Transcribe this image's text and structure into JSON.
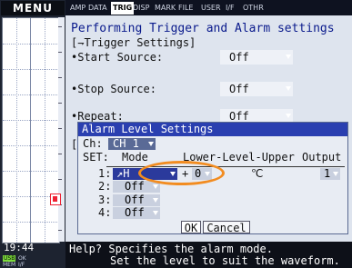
{
  "left": {
    "menu_label": "MENU",
    "time": "19:44",
    "usb_badge": "USB",
    "usb_sub": "MEM",
    "usb_menu": "OK\nI/F"
  },
  "tabs": [
    {
      "label": "AMP",
      "active": false
    },
    {
      "label": "DATA",
      "active": false
    },
    {
      "label": "TRIG",
      "active": true
    },
    {
      "label": "DISP",
      "active": false
    },
    {
      "label": "MARK",
      "active": false
    },
    {
      "label": "FILE",
      "active": false
    },
    {
      "label": "USER",
      "active": false
    },
    {
      "label": "I/F",
      "active": false
    },
    {
      "label": "OTHR",
      "active": false
    }
  ],
  "main": {
    "help_title": "Performing Trigger and Alarm settings",
    "section": "[⇁Trigger Settings]",
    "start_source_label": "•Start Source:",
    "start_source_value": "Off",
    "stop_source_label": "•Stop Source:",
    "stop_source_value": "Off",
    "repeat_label": "•Repeat:",
    "repeat_value": "Off",
    "hidden_bracket": "["
  },
  "dialog": {
    "title": "Alarm Level Settings",
    "ch_label": "Ch:",
    "ch_value": "CH 1",
    "set_label": "SET:",
    "col_mode": "Mode",
    "col_range": "Lower-Level-Upper",
    "col_output": "Output",
    "rows": [
      {
        "num": "1:",
        "mode": "↗H",
        "sign": "+",
        "level": "0",
        "unit": "℃",
        "output": "1"
      },
      {
        "num": "2:",
        "mode": "Off"
      },
      {
        "num": "3:",
        "mode": "Off"
      },
      {
        "num": "4:",
        "mode": "Off"
      }
    ],
    "ok_label": "OK",
    "cancel_label": "Cancel"
  },
  "helpbar": {
    "line1": "Help? Specifies the alarm mode.",
    "line2": "Set the level to suit the waveform."
  },
  "colors": {
    "dialog_title_bg": "#2a3fb0",
    "help_title_text": "#0a1a8c",
    "selected_dropdown": "#2b3a9c",
    "highlight_ring": "#f28c20",
    "alarm_marker": "#e23"
  }
}
